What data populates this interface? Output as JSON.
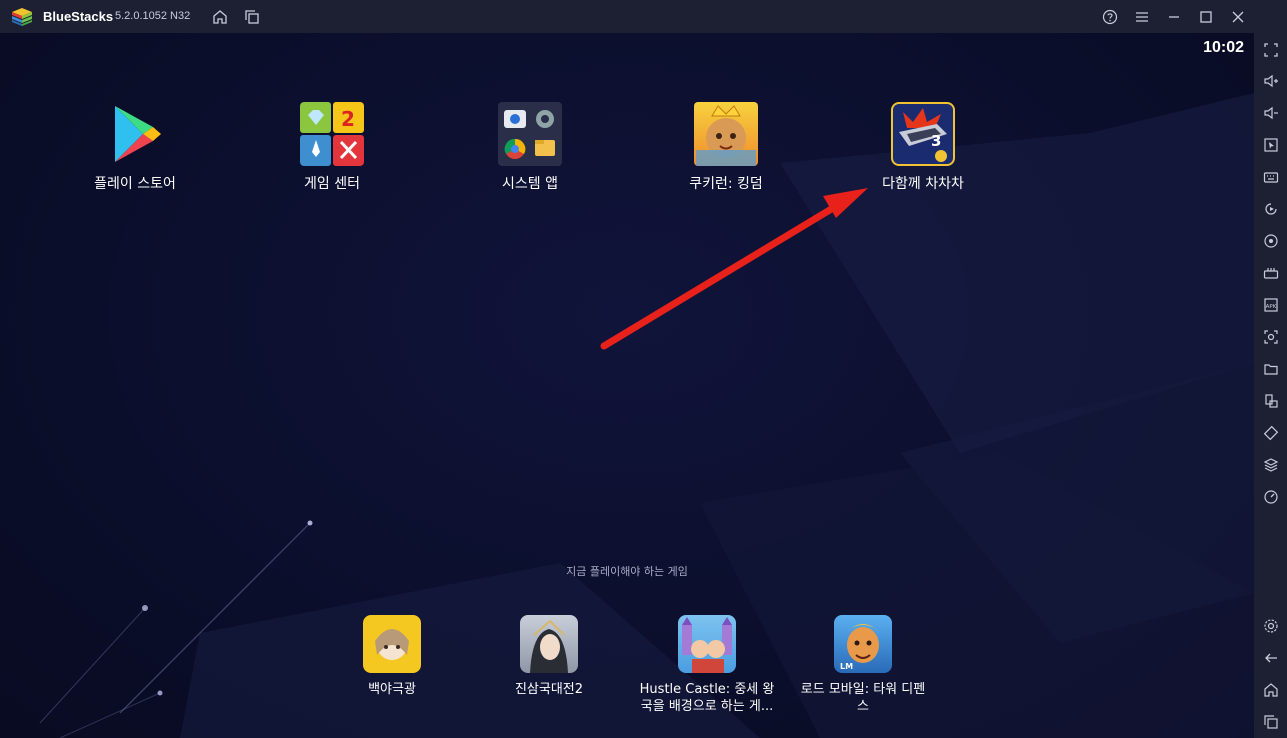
{
  "titlebar": {
    "app_name": "BlueStacks",
    "version": "5.2.0.1052 N32",
    "icons": [
      "home-icon",
      "multi-instance-icon",
      "help-icon",
      "menu-icon",
      "minimize-icon",
      "maximize-icon",
      "close-icon"
    ]
  },
  "status": {
    "time": "10:02"
  },
  "apps": [
    {
      "label": "플레이 스토어",
      "icon": "play-store-icon"
    },
    {
      "label": "게임 센터",
      "icon": "game-center-icon"
    },
    {
      "label": "시스템 앱",
      "icon": "system-apps-icon"
    },
    {
      "label": "쿠키런: 킹덤",
      "icon": "cookie-run-kingdom-icon"
    },
    {
      "label": "다함께 차차차",
      "icon": "dahamkke-chachacha-icon"
    }
  ],
  "recommended": {
    "heading": "지금 플레이해야 하는 게임",
    "items": [
      {
        "label": "백야극광",
        "icon": "alchemy-stars-icon"
      },
      {
        "label": "진삼국대전2",
        "icon": "jinsamguk-icon"
      },
      {
        "label": "Hustle Castle: 중세 왕국을 배경으로 하는 게...",
        "label_line1": "Hustle Castle: 중세 왕",
        "label_line2": "국을 배경으로 하는 게...",
        "icon": "hustle-castle-icon"
      },
      {
        "label": "로드 모바일: 타워 디펜스",
        "label_line1": "로드 모바일: 타워 디펜",
        "label_line2": "스",
        "icon": "lords-mobile-icon"
      }
    ]
  },
  "sidebar": {
    "icons": [
      "fullscreen-icon",
      "volume-up-icon",
      "volume-down-icon",
      "pointer-icon",
      "keyboard-icon",
      "macro-record-icon",
      "macro-play-icon",
      "gamepad-icon",
      "apk-install-icon",
      "screenshot-icon",
      "folder-icon",
      "multi-instance-manager-icon",
      "rotate-icon",
      "layers-icon",
      "performance-icon",
      "settings-icon",
      "back-icon",
      "home-icon",
      "recent-apps-icon"
    ]
  },
  "colors": {
    "titlebar": "#1d2033",
    "background": "#0b0e2a",
    "arrow": "#e8211b"
  }
}
